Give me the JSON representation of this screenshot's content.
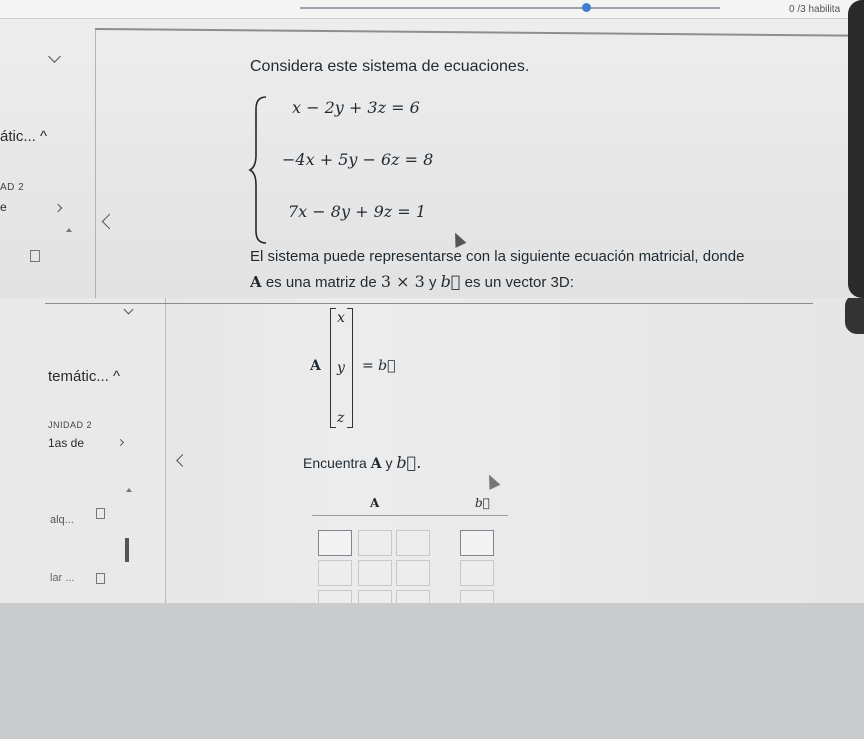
{
  "header": {
    "progress_text": "0 /3 habilita"
  },
  "colors": {
    "accent": "#3f7fd0",
    "sidebar_bg": "#e9e9e9",
    "page_bg": "#c9cbcc"
  },
  "top_sidebar": {
    "section_title": "átic... ^",
    "unit_label": "AD 2",
    "item_label": "e"
  },
  "question": {
    "intro": "Considera este sistema de ecuaciones.",
    "equations": [
      "x − 2y + 3z = 6",
      "−4x + 5y − 6z = 8",
      "7x − 8y + 9z = 1"
    ],
    "representation_line1": "El sistema puede representarse con la siguiente ecuación matricial, donde",
    "rep_A": "A",
    "rep_mid": "es una matriz de",
    "rep_dims": "3 × 3",
    "rep_y": "y",
    "rep_b": "b⃗",
    "rep_end": "es un vector 3D:"
  },
  "bottom_sidebar": {
    "section_title": "temátic... ^",
    "unit_label": "JNIDAD 2",
    "item_label": "1as de",
    "entry1": "alq...",
    "entry2": "lar ..."
  },
  "matrix_equation": {
    "A": "A",
    "vector": [
      "x",
      "y",
      "z"
    ],
    "equals": "= b⃗"
  },
  "answer": {
    "prompt": "Encuentra",
    "prompt_A": "A",
    "prompt_y": "y",
    "prompt_b": "b⃗.",
    "col_A": "A",
    "col_b": "b⃗"
  },
  "icons": [
    "chevron-down-icon",
    "chevron-up-icon",
    "chevron-right-icon",
    "chevron-left-icon",
    "document-icon",
    "cursor-icon"
  ]
}
